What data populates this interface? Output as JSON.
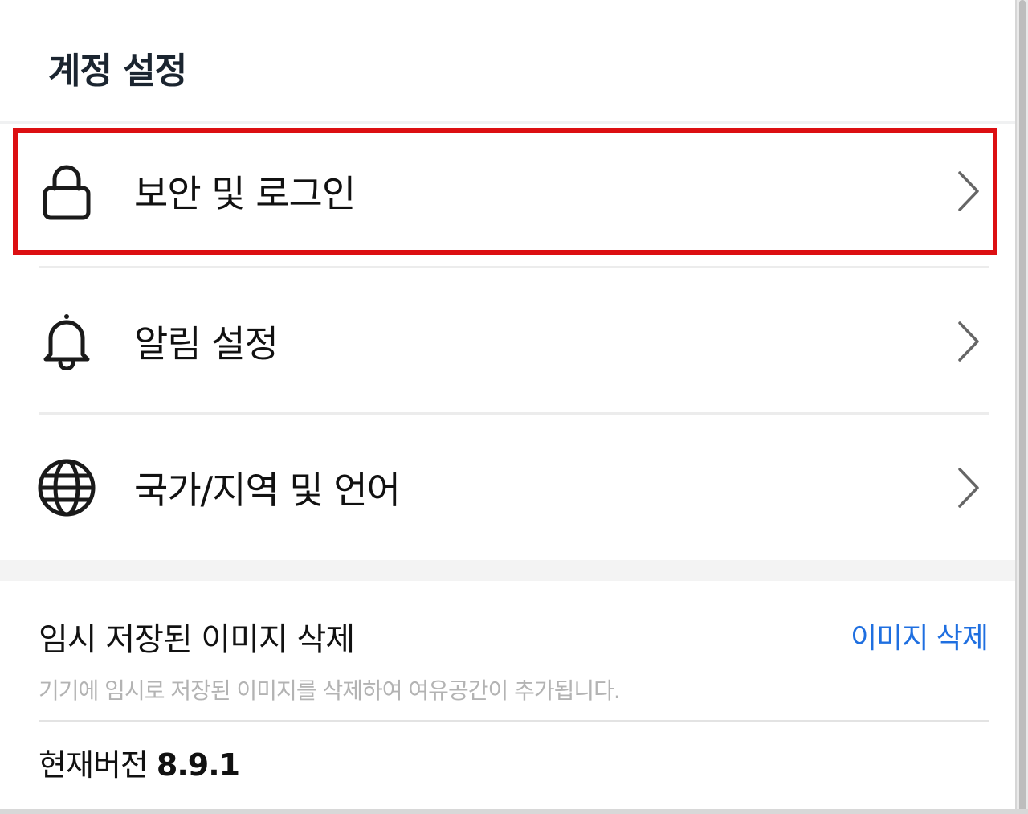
{
  "header": {
    "title": "계정 설정"
  },
  "menu": {
    "items": [
      {
        "label": "보안 및 로그인",
        "icon": "lock-icon",
        "highlighted": true
      },
      {
        "label": "알림 설정",
        "icon": "bell-icon",
        "highlighted": false
      },
      {
        "label": "국가/지역 및 언어",
        "icon": "globe-icon",
        "highlighted": false
      }
    ]
  },
  "cache": {
    "title": "임시 저장된 이미지 삭제",
    "button_label": "이미지 삭제",
    "description": "기기에 임시로 저장된 이미지를 삭제하여 여유공간이 추가됩니다."
  },
  "version": {
    "label": "현재버전",
    "number": "8.9.1"
  },
  "colors": {
    "highlight": "#dc0f12",
    "link": "#1f6fe0",
    "muted_text": "#b3b3b3"
  }
}
